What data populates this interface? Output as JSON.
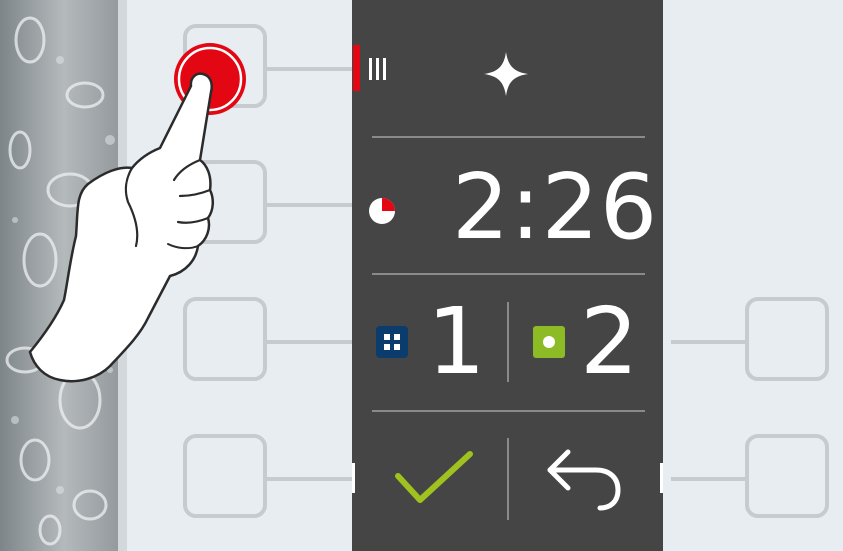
{
  "display": {
    "row1": {
      "level_icon": "level-bars-icon",
      "mode_icon": "sparkle-icon"
    },
    "row2": {
      "timer_icon": "timer-pie-icon",
      "time": "2:26"
    },
    "row3": {
      "left": {
        "icon": "grid-dots-icon",
        "value": "1",
        "color": "#0b3c6e"
      },
      "right": {
        "icon": "square-dot-icon",
        "value": "2",
        "color": "#8dbb25"
      }
    },
    "row4": {
      "confirm_icon": "checkmark-icon",
      "back_icon": "back-arrow-icon"
    }
  },
  "colors": {
    "accent_red": "#e30613",
    "check_green": "#9fc21f",
    "panel_dark": "#454545",
    "key_outline": "#c5cbcf"
  },
  "gesture": {
    "icon": "pointing-hand-icon",
    "target": "top-left-key"
  }
}
